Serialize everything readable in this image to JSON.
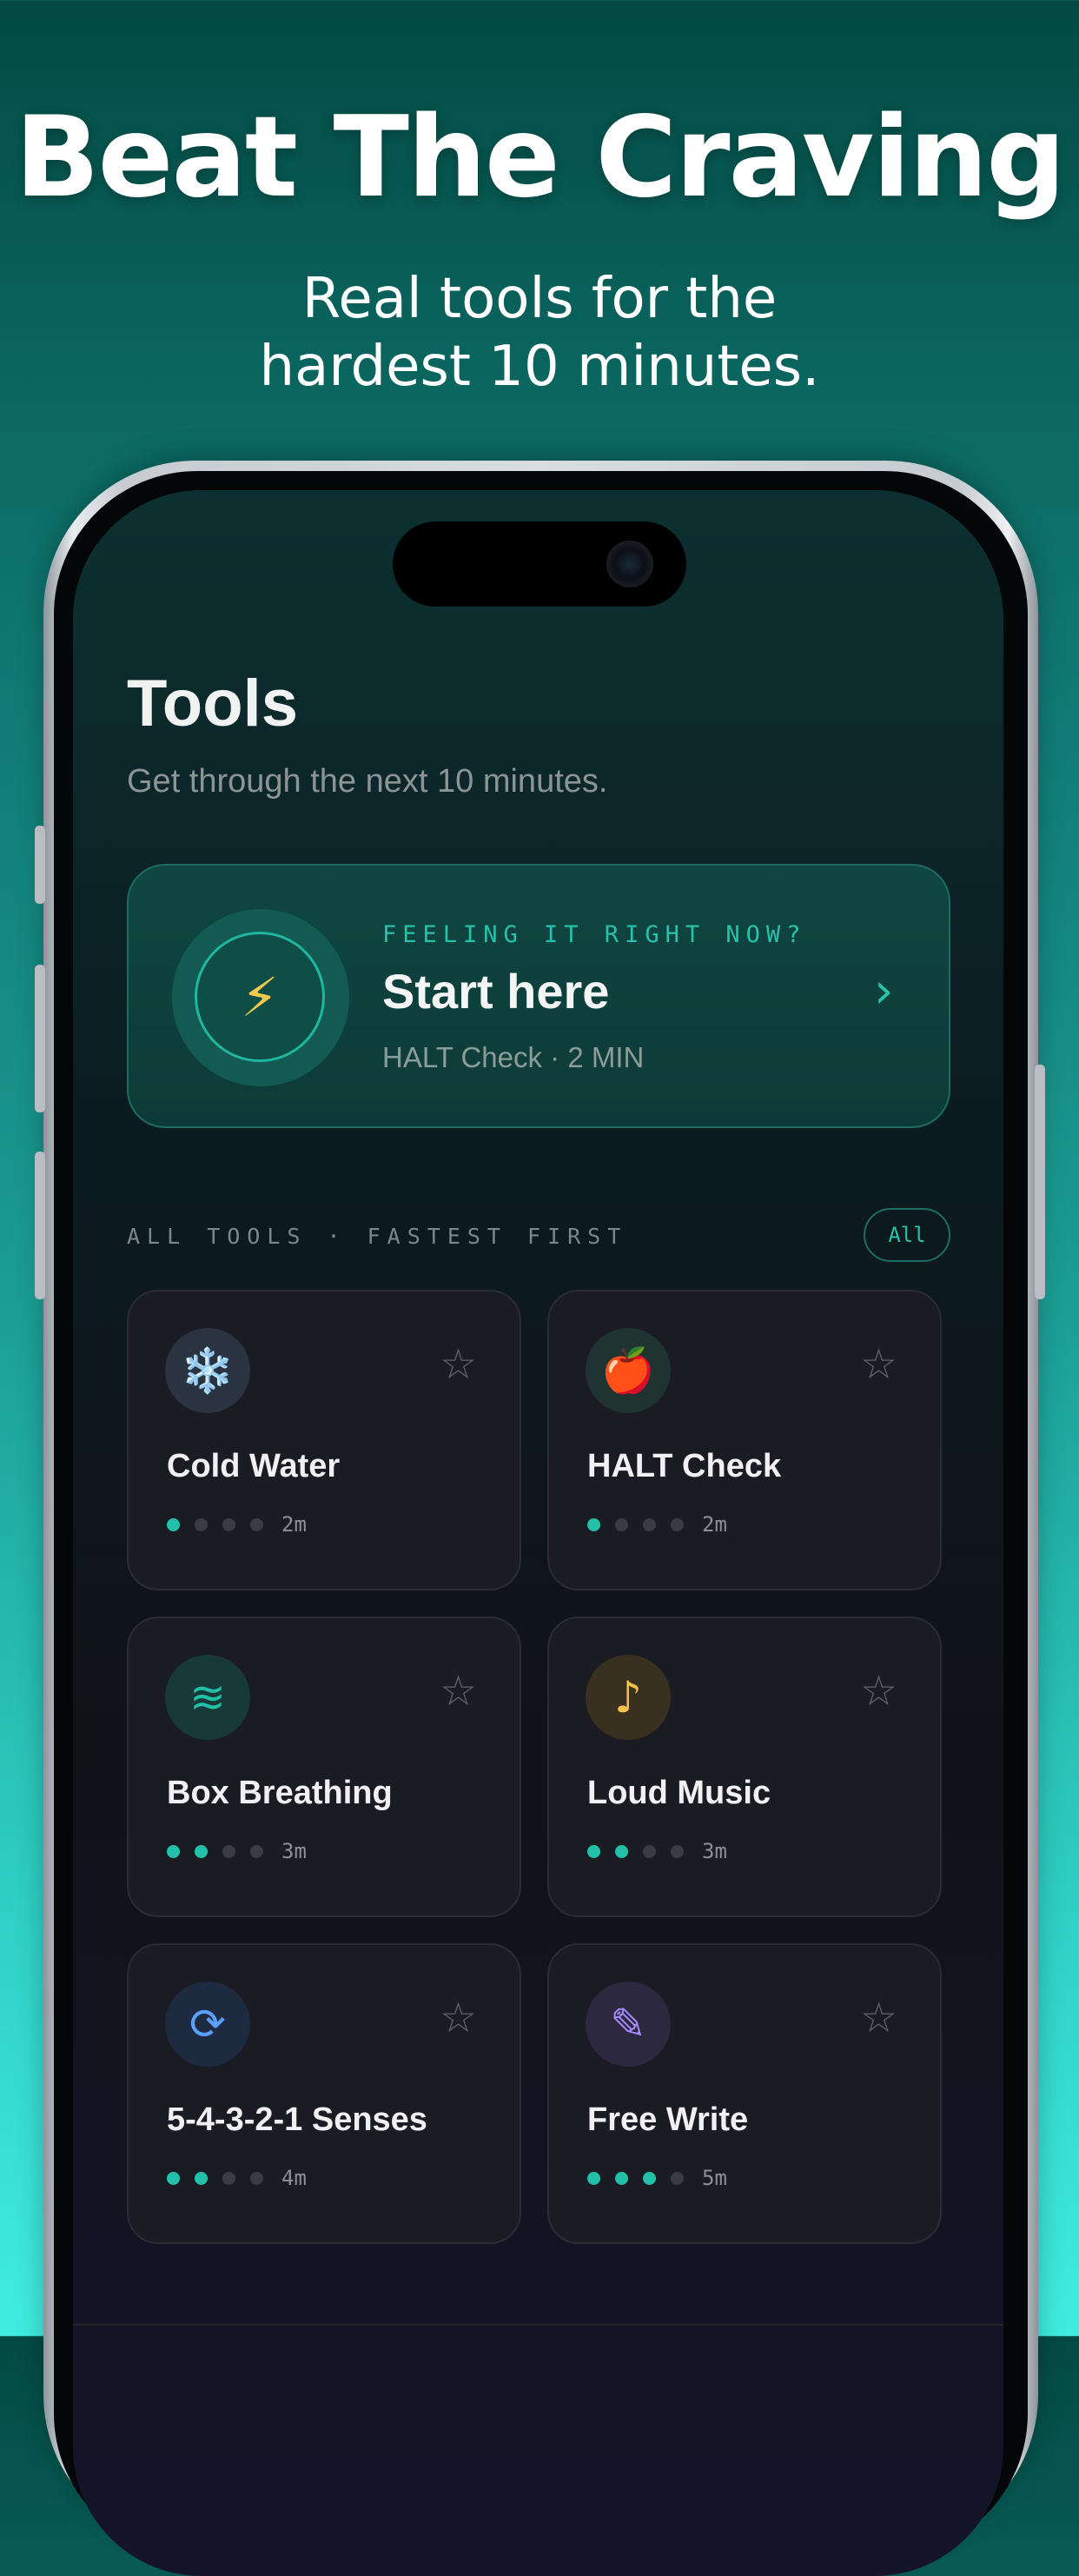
{
  "marketing": {
    "headline": "Beat The Craving",
    "subhead_line1": "Real tools for the",
    "subhead_line2": "hardest 10 minutes."
  },
  "screen": {
    "title": "Tools",
    "subtitle": "Get through the next 10 minutes.",
    "hero": {
      "kicker": "FEELING IT RIGHT NOW?",
      "title": "Start here",
      "meta": "HALT Check · 2 MIN",
      "icon": "lightning-bolt-icon",
      "chevron": "›"
    },
    "section_label": "ALL TOOLS · FASTEST FIRST",
    "filter_label": "All",
    "tools": [
      {
        "name": "Cold Water",
        "duration": "2m",
        "intensity": 1,
        "icon": "snowflake-icon",
        "glyph": "❄️",
        "icon_bg": "#2a3440",
        "icon_color": "#8fd3ff"
      },
      {
        "name": "HALT Check",
        "duration": "2m",
        "intensity": 1,
        "icon": "apple-icon",
        "glyph": "🍎",
        "icon_bg": "#1f3330",
        "icon_color": "#e0342e"
      },
      {
        "name": "Box Breathing",
        "duration": "3m",
        "intensity": 2,
        "icon": "waves-icon",
        "glyph": "≋",
        "icon_bg": "#173a38",
        "icon_color": "#22c0a8"
      },
      {
        "name": "Loud Music",
        "duration": "3m",
        "intensity": 2,
        "icon": "music-note-icon",
        "glyph": "♪",
        "icon_bg": "#3a3020",
        "icon_color": "#f2c14e"
      },
      {
        "name": "5-4-3-2-1 Senses",
        "duration": "4m",
        "intensity": 2,
        "icon": "refresh-icon",
        "glyph": "⟳",
        "icon_bg": "#1e2a40",
        "icon_color": "#5aa0ff"
      },
      {
        "name": "Free Write",
        "duration": "5m",
        "intensity": 3,
        "icon": "pencil-icon",
        "glyph": "✎",
        "icon_bg": "#2b2840",
        "icon_color": "#a78bfa"
      }
    ],
    "star_glyph": "☆"
  },
  "colors": {
    "accent": "#22c0a8",
    "card_bg": "#1b1b23",
    "dot_off": "#3a3b44"
  }
}
